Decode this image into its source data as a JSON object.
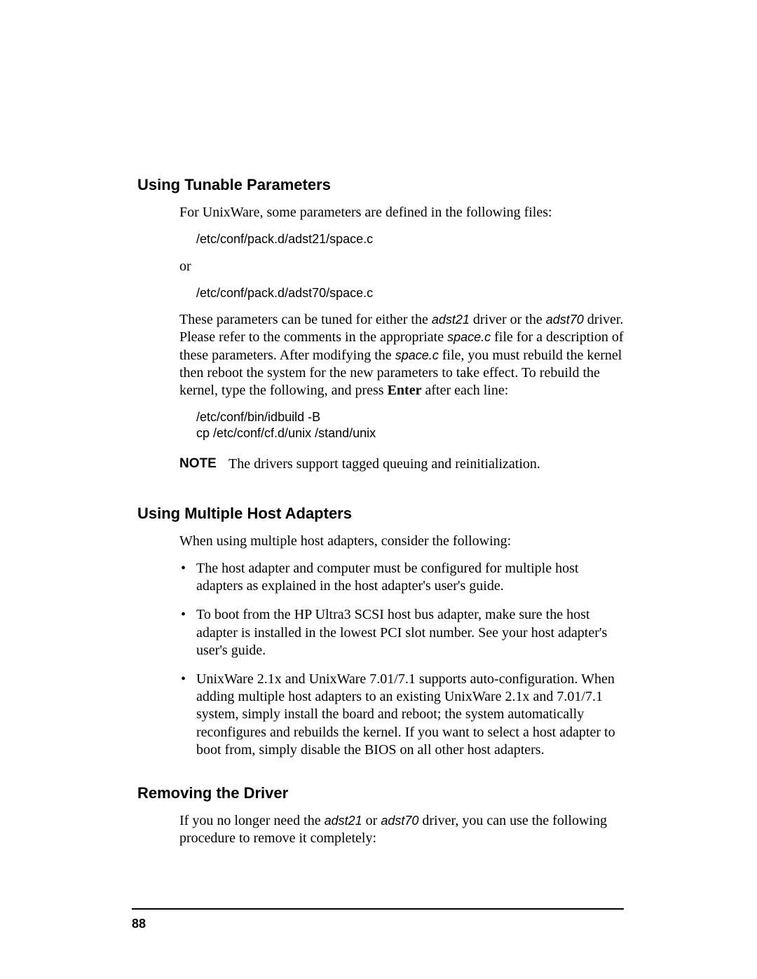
{
  "section1": {
    "heading": "Using Tunable Parameters",
    "intro": "For UnixWare, some parameters are defined in the following files:",
    "file1": "/etc/conf/pack.d/adst21/space.c",
    "or": "or",
    "file2": "/etc/conf/pack.d/adst70/space.c",
    "para2_a": "These parameters can be tuned for either the ",
    "adst21": "adst21",
    "para2_b": " driver or the ",
    "adst70": "adst70",
    "para2_c": " driver. Please refer to the comments in the appropriate ",
    "spacec1": "space.c",
    "para2_d": " file for a description of these parameters. After modifying the ",
    "spacec2": "space.c",
    "para2_e": " file, you must rebuild the kernel then reboot the system for the new parameters to take effect. To rebuild the kernel, type the following, and press ",
    "enter": "Enter",
    "para2_f": " after each line:",
    "cmd": "/etc/conf/bin/idbuild  -B\ncp  /etc/conf/cf.d/unix  /stand/unix",
    "note_label": "NOTE",
    "note_text": "The drivers support tagged queuing and reinitialization."
  },
  "section2": {
    "heading": "Using Multiple Host Adapters",
    "intro": "When using multiple host adapters, consider the following:",
    "bullets": [
      "The host adapter and computer must be configured for multiple host adapters as explained in the host adapter's user's guide.",
      "To boot from the HP Ultra3 SCSI host bus adapter, make sure the host adapter is installed in the lowest PCI slot number. See your host adapter's user's guide.",
      "UnixWare 2.1x and UnixWare 7.01/7.1 supports auto-configuration. When adding multiple host adapters to an existing UnixWare 2.1x and 7.01/7.1 system, simply install the board and reboot; the system automatically reconfigures and rebuilds the kernel. If you want to select a host adapter to boot from, simply disable the BIOS on all other host adapters."
    ]
  },
  "section3": {
    "heading": "Removing the Driver",
    "para_a": "If you no longer need the ",
    "adst21": "adst21",
    "para_b": " or ",
    "adst70": "adst70",
    "para_c": " driver, you can use the following procedure to remove it completely:"
  },
  "page_number": "88"
}
